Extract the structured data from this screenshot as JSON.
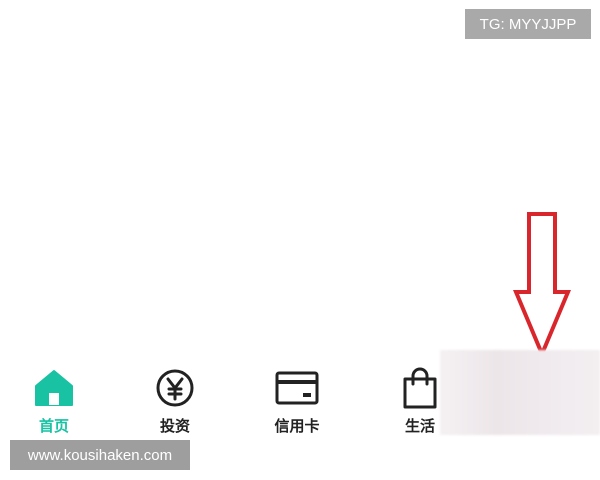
{
  "watermarks": {
    "top": "TG: MYYJJPP",
    "bottom": "www.kousihaken.com"
  },
  "tabbar": {
    "items": [
      {
        "label": "首页",
        "icon": "home-icon",
        "active": true
      },
      {
        "label": "投资",
        "icon": "yen-coin-icon",
        "active": false
      },
      {
        "label": "信用卡",
        "icon": "credit-card-icon",
        "active": false
      },
      {
        "label": "生活",
        "icon": "shopping-bag-icon",
        "active": false
      }
    ]
  },
  "colors": {
    "accent": "#19c2a3",
    "arrow": "#d9262c",
    "text": "#222222"
  }
}
